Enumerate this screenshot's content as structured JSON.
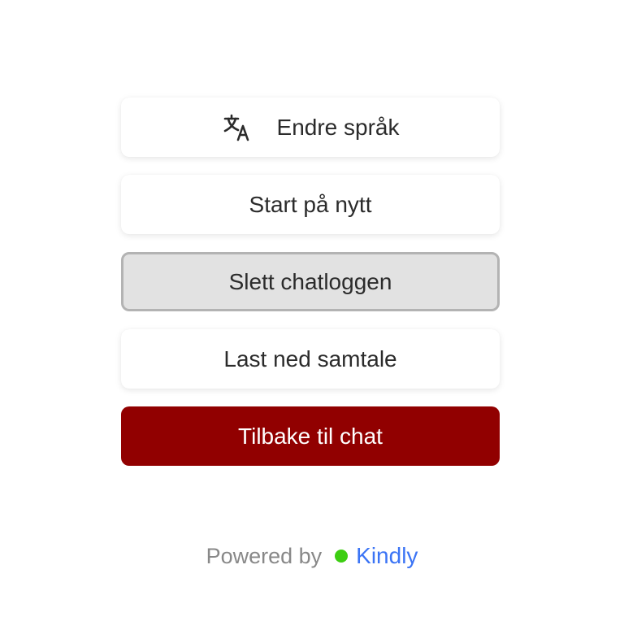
{
  "menu": {
    "change_language": {
      "label": "Endre språk",
      "icon": "translate-icon"
    },
    "restart": {
      "label": "Start på nytt"
    },
    "delete_log": {
      "label": "Slett chatloggen"
    },
    "download": {
      "label": "Last ned samtale"
    },
    "back": {
      "label": "Tilbake til chat"
    }
  },
  "footer": {
    "powered_by": "Powered by",
    "brand": "Kindly",
    "brand_color": "#3b74f5",
    "dot_color": "#3dce12"
  },
  "colors": {
    "primary": "#910000",
    "active_bg": "#e2e2e2"
  }
}
